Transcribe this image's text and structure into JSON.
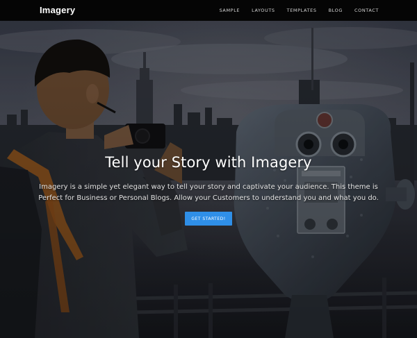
{
  "nav": {
    "brand": "Imagery",
    "links": [
      "SAMPLE",
      "LAYOUTS",
      "TEMPLATES",
      "BLOG",
      "CONTACT"
    ]
  },
  "hero": {
    "title": "Tell your Story with Imagery",
    "text": "Imagery is a simple yet elegant way to tell your story and captivate your audience. This theme is Perfect for Business or Personal Blogs. Allow your Customers to understand you and what you do.",
    "cta_label": "GET STARTED!",
    "image_description_icon": "photo-icon"
  },
  "colors": {
    "nav_bg": "#050505",
    "cta_bg": "#2f8fe8",
    "text_light": "#ffffff"
  }
}
